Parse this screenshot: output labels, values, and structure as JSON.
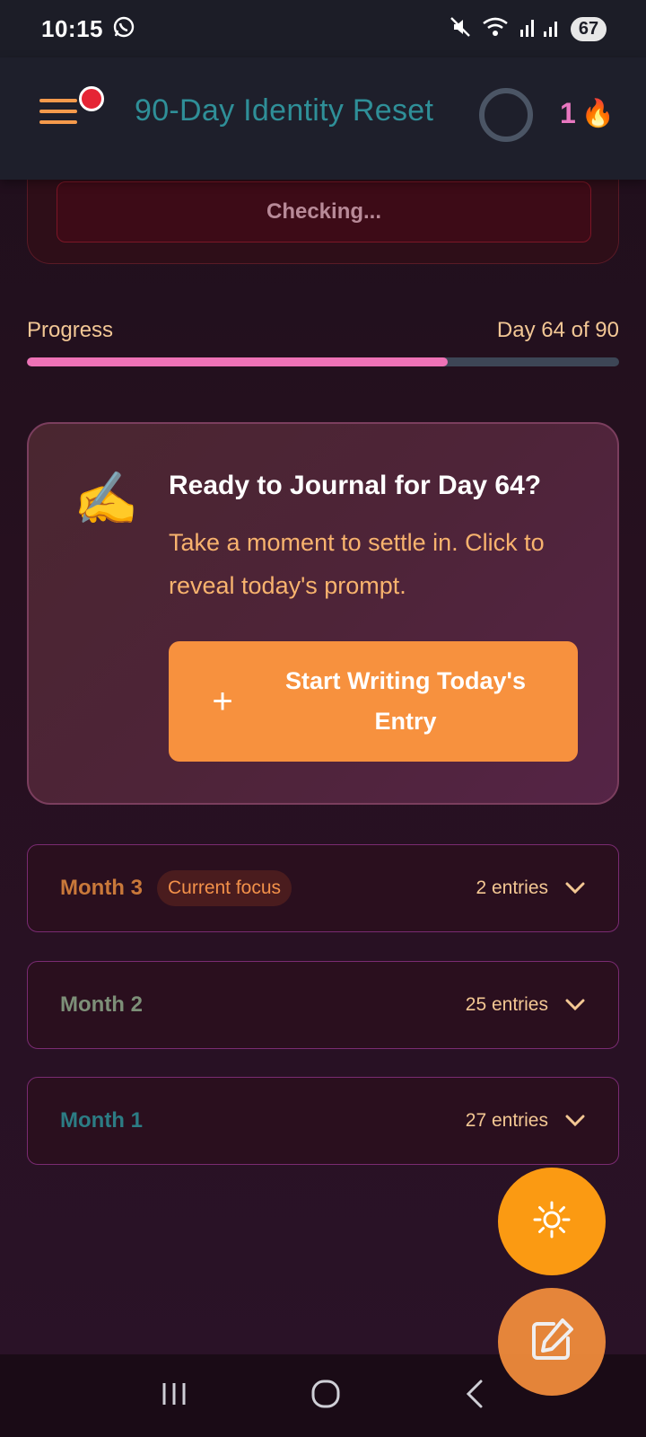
{
  "status_bar": {
    "time": "10:15",
    "battery": "67",
    "icons": [
      "whatsapp-icon",
      "mute-icon",
      "wifi-icon",
      "signal-icon"
    ]
  },
  "header": {
    "title": "90-Day Identity Reset",
    "streak_count": "1",
    "streak_icon": "🔥",
    "notification_dot": true
  },
  "check_card": {
    "status_text": "Checking..."
  },
  "progress": {
    "label": "Progress",
    "day_text": "Day 64 of 90",
    "fraction": 0.711
  },
  "journal": {
    "emoji": "✍️",
    "title": "Ready to Journal for Day 64?",
    "description": "Take a moment to settle in. Click to reveal today's prompt.",
    "button_label": "Start Writing Today's Entry",
    "button_icon": "+"
  },
  "months": [
    {
      "name": "Month 3",
      "badge": "Current focus",
      "entries": "2 entries",
      "color": "#c9783a"
    },
    {
      "name": "Month 2",
      "badge": "",
      "entries": "25 entries",
      "color": "#7d8f78"
    },
    {
      "name": "Month 1",
      "badge": "",
      "entries": "27 entries",
      "color": "#2c7c84"
    }
  ],
  "colors": {
    "accent": "#f7913e",
    "progress": "#ee72b6",
    "title": "#2f8f98"
  }
}
